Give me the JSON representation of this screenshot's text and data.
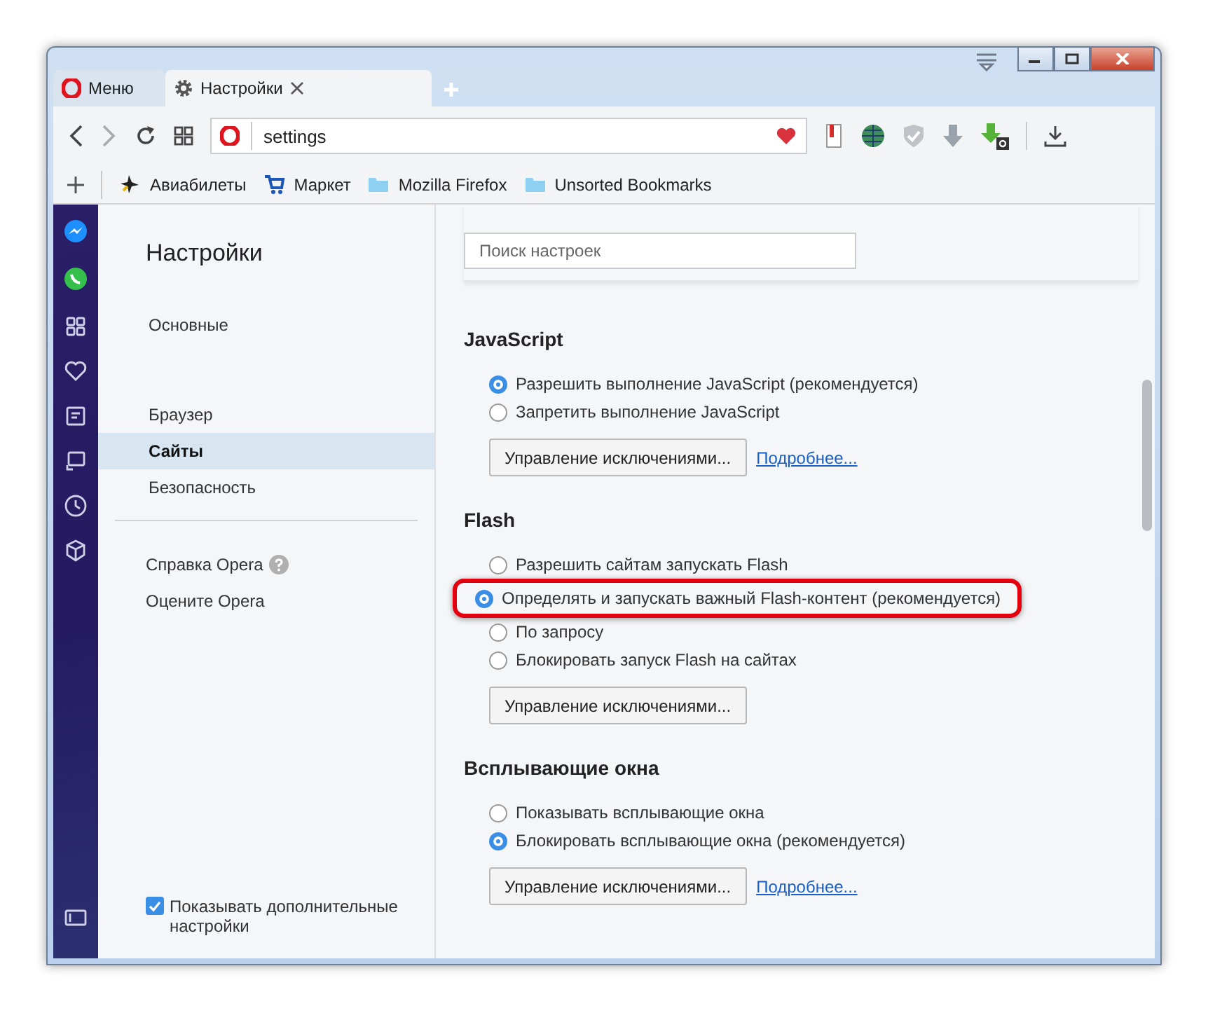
{
  "tabs": [
    {
      "label": "Меню",
      "kind": "menu",
      "selected": false
    },
    {
      "label": "Настройки",
      "kind": "page",
      "selected": true
    }
  ],
  "address": {
    "value": "settings"
  },
  "bookmarks": [
    {
      "label": "Авиабилеты",
      "kind": "plane"
    },
    {
      "label": "Маркет",
      "kind": "cart"
    },
    {
      "label": "Mozilla Firefox",
      "kind": "folder"
    },
    {
      "label": "Unsorted Bookmarks",
      "kind": "folder"
    }
  ],
  "nav": {
    "title": "Настройки",
    "groups": [
      {
        "items": [
          {
            "label": "Основные",
            "selected": false
          }
        ]
      },
      {
        "items": [
          {
            "label": "Браузер",
            "selected": false
          },
          {
            "label": "Сайты",
            "selected": true
          },
          {
            "label": "Безопасность",
            "selected": false
          }
        ]
      }
    ],
    "links": [
      {
        "label": "Справка Opera",
        "help": true
      },
      {
        "label": "Оцените Opera",
        "help": false
      }
    ],
    "advanced": {
      "label": "Показывать дополнительные настройки",
      "checked": true
    }
  },
  "search": {
    "placeholder": "Поиск настроек"
  },
  "sections": [
    {
      "title": "JavaScript",
      "options": [
        {
          "label": "Разрешить выполнение JavaScript (рекомендуется)",
          "selected": true,
          "highlighted": false
        },
        {
          "label": "Запретить выполнение JavaScript",
          "selected": false,
          "highlighted": false
        }
      ],
      "button": "Управление исключениями...",
      "link": "Подробнее..."
    },
    {
      "title": "Flash",
      "options": [
        {
          "label": "Разрешить сайтам запускать Flash",
          "selected": false,
          "highlighted": false
        },
        {
          "label": "Определять и запускать важный Flash-контент (рекомендуется)",
          "selected": true,
          "highlighted": true
        },
        {
          "label": "По запросу",
          "selected": false,
          "highlighted": false
        },
        {
          "label": "Блокировать запуск Flash на сайтах",
          "selected": false,
          "highlighted": false
        }
      ],
      "button": "Управление исключениями..."
    },
    {
      "title": "Всплывающие окна",
      "options": [
        {
          "label": "Показывать всплывающие окна",
          "selected": false,
          "highlighted": false
        },
        {
          "label": "Блокировать всплывающие окна (рекомендуется)",
          "selected": true,
          "highlighted": false
        }
      ],
      "button": "Управление исключениями...",
      "link": "Подробнее..."
    }
  ]
}
